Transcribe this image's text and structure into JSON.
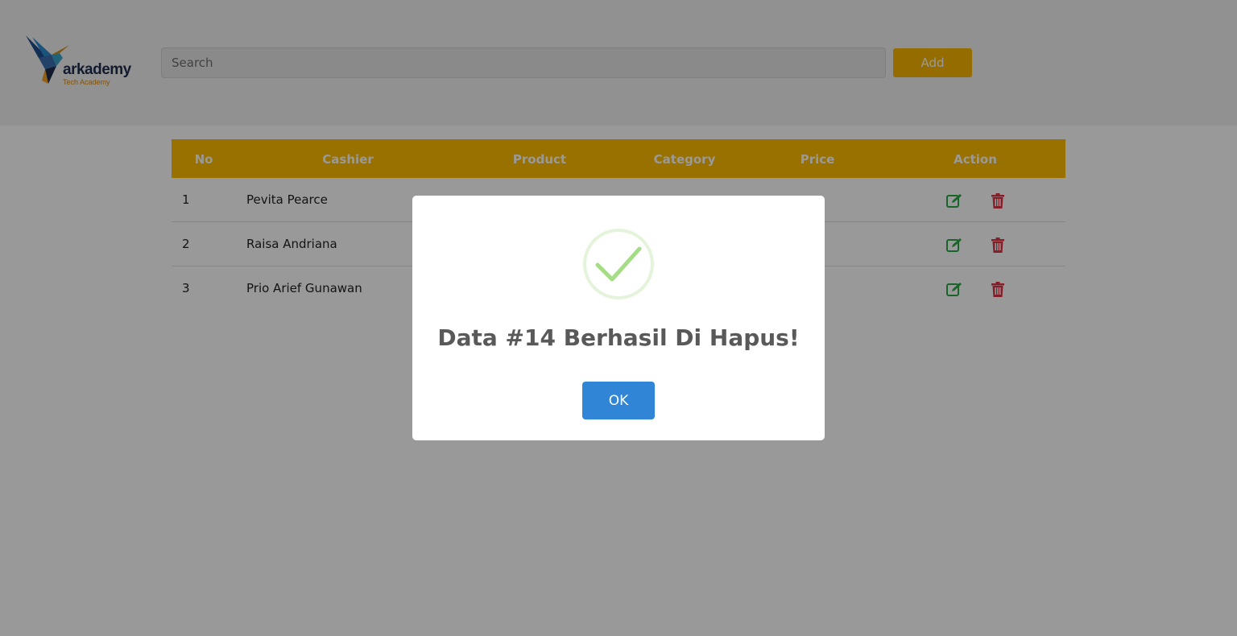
{
  "header": {
    "logo_text": "arkademy",
    "logo_subtext": "Tech Academy",
    "search_placeholder": "Search",
    "add_label": "Add"
  },
  "table": {
    "columns": [
      "No",
      "Cashier",
      "Product",
      "Category",
      "Price",
      "Action"
    ],
    "rows": [
      {
        "no": "1",
        "cashier": "Pevita Pearce"
      },
      {
        "no": "2",
        "cashier": "Raisa Andriana"
      },
      {
        "no": "3",
        "cashier": "Prio Arief Gunawan"
      }
    ]
  },
  "modal": {
    "icon": "success-check-icon",
    "title": "Data #14 Berhasil Di Hapus!",
    "ok_label": "OK"
  },
  "colors": {
    "accent": "#ffbd00",
    "edit": "#28a745",
    "delete": "#dc3545",
    "ok_button": "#3085d6",
    "success": "#a5dc86"
  }
}
